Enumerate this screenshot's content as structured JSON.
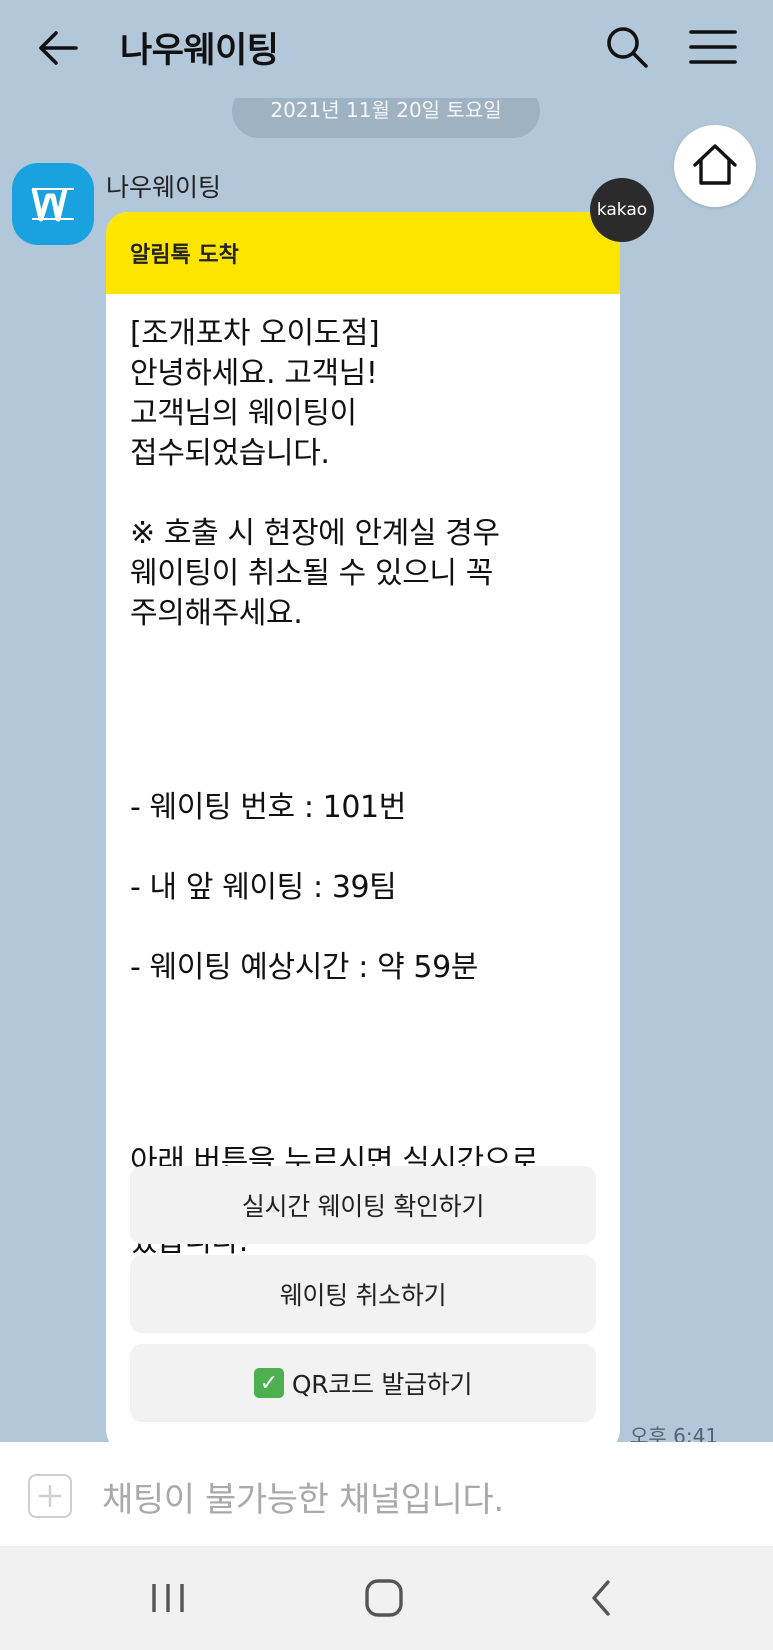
{
  "header": {
    "title": "나우웨이팅",
    "back_icon": "arrow-left-icon",
    "search_icon": "search-icon",
    "menu_icon": "hamburger-menu-icon"
  },
  "chat": {
    "date_divider": "2021년 11월 20일 토요일",
    "sender_name": "나우웨이팅",
    "kakao_badge": "kakao",
    "bubble_header": "알림톡 도착",
    "message_intro": "[조개포차 오이도점]\n안녕하세요. 고객님!\n고객님의 웨이팅이\n접수되었습니다.\n\n※ 호출 시 현장에 안계실 경우\n웨이팅이 취소될 수 있으니 꼭\n주의해주세요.",
    "details": [
      "- 웨이팅 번호 : 101번",
      "- 내 앞 웨이팅 : 39팀",
      "- 웨이팅 예상시간 : 약 59분"
    ],
    "message_outro": "아래 버튼을 누르시면 실시간으로\n웨이팅 상황을 확인하실 수\n있습니다.",
    "buttons": {
      "realtime": "실시간 웨이팅 확인하기",
      "cancel": "웨이팅 취소하기",
      "qr": "QR코드 발급하기"
    },
    "time": "오후 6:41"
  },
  "input": {
    "placeholder": "채팅이 불가능한 채널입니다."
  },
  "colors": {
    "background": "#b2c7da",
    "header_yellow": "#fee500",
    "avatar_blue": "#1aa1e0"
  }
}
